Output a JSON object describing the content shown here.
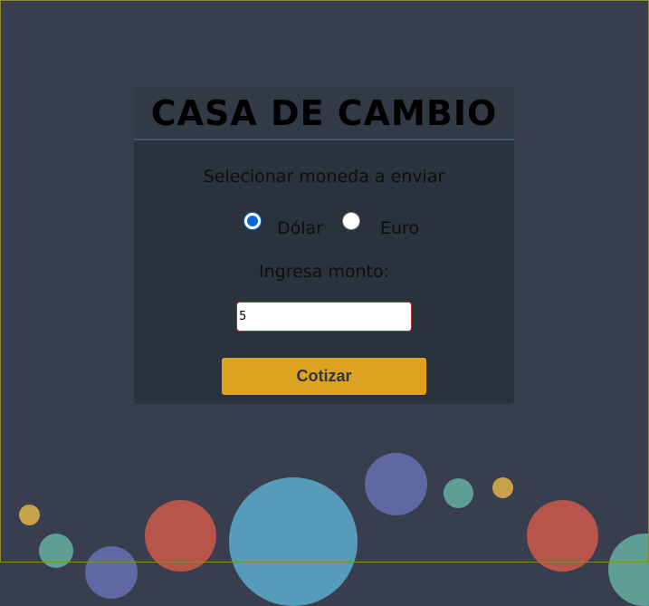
{
  "header": {
    "title": "CASA DE CAMBIO"
  },
  "form": {
    "subtitle": "Selecionar moneda a enviar",
    "currency_options": [
      {
        "label": "Dólar",
        "selected": true
      },
      {
        "label": "Euro",
        "selected": false
      }
    ],
    "amount_label": "Ingresa monto:",
    "amount_value": "5",
    "submit_label": "Cotizar"
  },
  "colors": {
    "background": "#393e4f",
    "card": "#2a333d",
    "button": "#dca320",
    "bubble_teal": "#5e9e94",
    "bubble_purple": "#5f68a3",
    "bubble_red": "#b8554a",
    "bubble_blue": "#579bbb",
    "bubble_gold": "#c8a24a"
  }
}
